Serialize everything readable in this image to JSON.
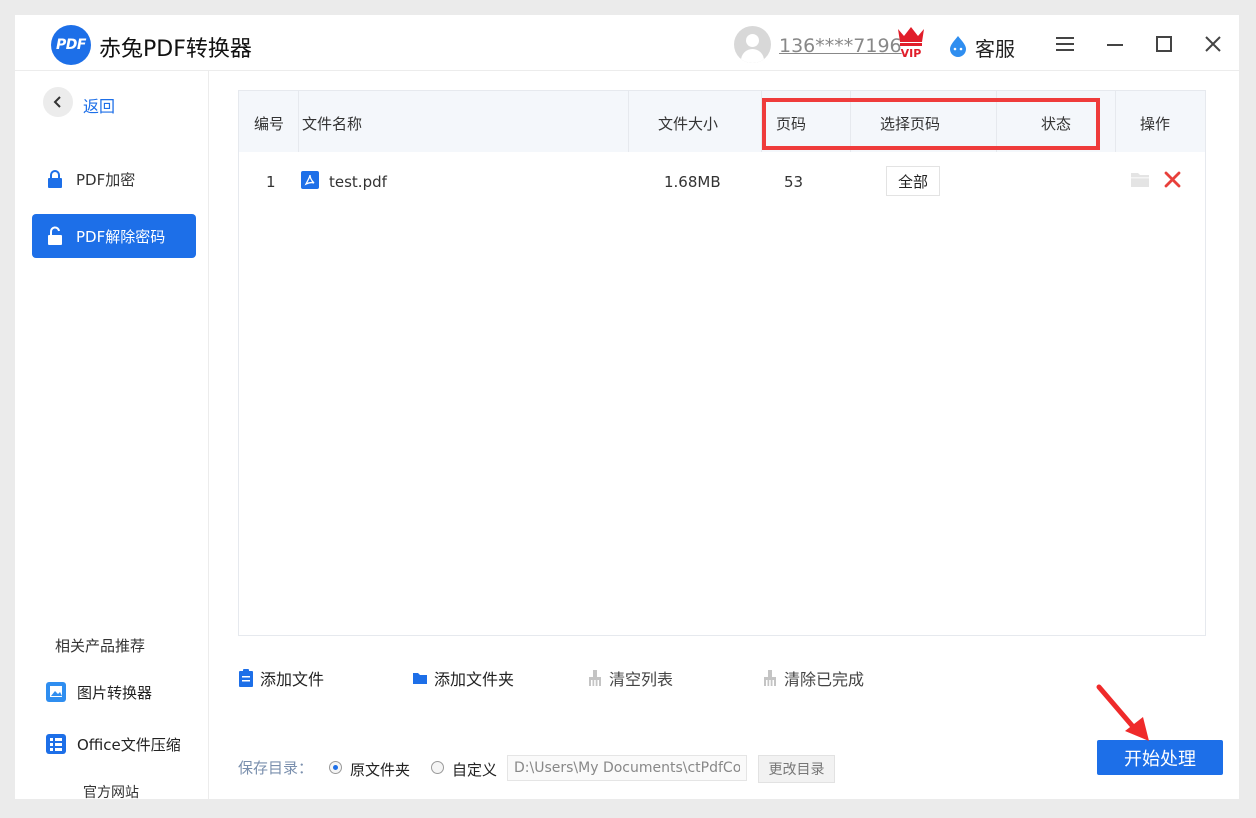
{
  "app": {
    "title": "赤兔PDF转换器",
    "logo_text": "PDF"
  },
  "header": {
    "user_phone": "136****7196",
    "vip_label": "VIP",
    "service_label": "客服"
  },
  "sidebar": {
    "back_label": "返回",
    "items": [
      {
        "label": "PDF加密",
        "active": false
      },
      {
        "label": "PDF解除密码",
        "active": true
      }
    ],
    "related_title": "相关产品推荐",
    "products": [
      {
        "label": "图片转换器"
      },
      {
        "label": "Office文件压缩"
      }
    ],
    "official_site": "官方网站"
  },
  "table": {
    "columns": {
      "index": "编号",
      "name": "文件名称",
      "size": "文件大小",
      "pages": "页码",
      "select_pages": "选择页码",
      "status": "状态",
      "actions": "操作"
    },
    "rows": [
      {
        "index": "1",
        "name": "test.pdf",
        "size": "1.68MB",
        "pages": "53",
        "select_pages": "全部",
        "status": ""
      }
    ]
  },
  "toolbar": {
    "add_file": "添加文件",
    "add_folder": "添加文件夹",
    "clear_list": "清空列表",
    "clear_done": "清除已完成"
  },
  "save": {
    "label": "保存目录：",
    "option_original": "原文件夹",
    "option_custom": "自定义",
    "selected": "原文件夹",
    "path_value": "D:\\Users\\My Documents\\ctPdfCon",
    "change_dir": "更改目录",
    "start": "开始处理"
  },
  "colors": {
    "accent": "#1d6fe8",
    "highlight_box": "#ef3b3b",
    "delete": "#e8403b"
  }
}
